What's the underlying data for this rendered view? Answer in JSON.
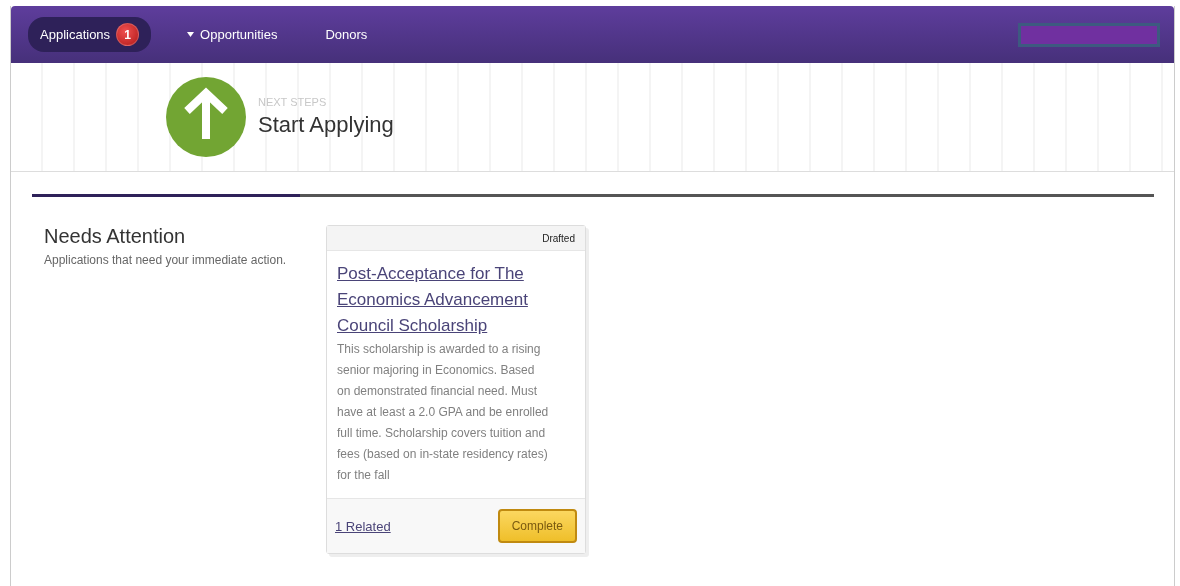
{
  "nav": {
    "items": [
      {
        "label": "Applications",
        "badge": "1",
        "caret": false,
        "selected": true
      },
      {
        "label": "Opportunities",
        "caret": true,
        "selected": false
      },
      {
        "label": "Donors",
        "caret": false,
        "selected": false
      }
    ]
  },
  "header": {
    "eyebrow": "NEXT STEPS",
    "title": "Start Applying"
  },
  "section": {
    "title": "Needs Attention",
    "description": "Applications that need your immediate action.",
    "cards": [
      {
        "status": "Drafted",
        "title": "Post-Acceptance for The Economics Advancement Council Scholarship",
        "description": "This scholarship is awarded to a rising senior majoring in Economics. Based on demonstrated financial need. Must have at least a 2.0 GPA and be enrolled full time. Scholarship covers tuition and fees (based on in-state residency rates) for the fall",
        "related": "1 Related",
        "action": "Complete"
      }
    ]
  }
}
